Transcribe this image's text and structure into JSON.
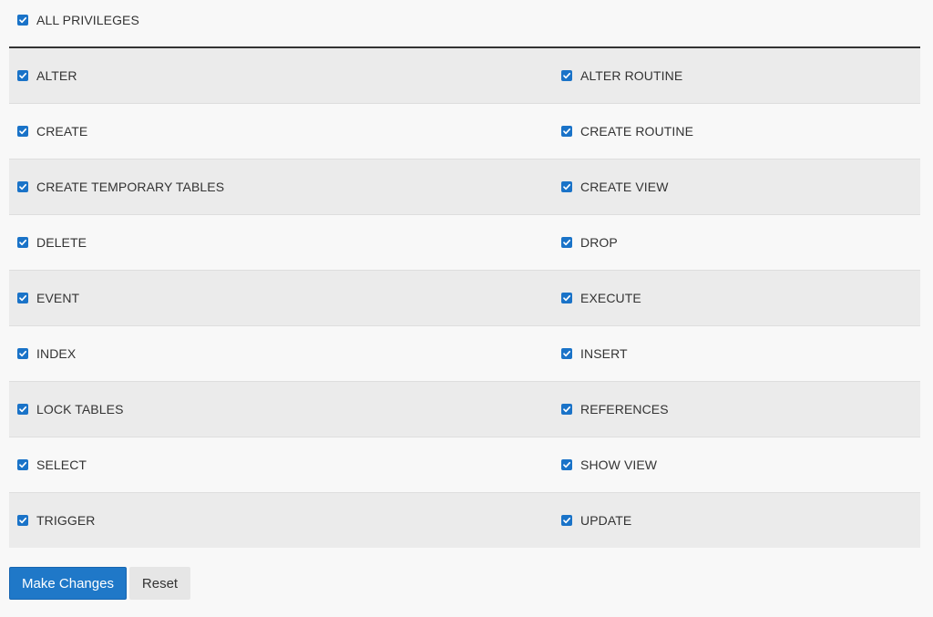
{
  "all_privileges": {
    "label": "ALL PRIVILEGES",
    "checked": true
  },
  "privileges": [
    {
      "left": "ALTER",
      "right": "ALTER ROUTINE"
    },
    {
      "left": "CREATE",
      "right": "CREATE ROUTINE"
    },
    {
      "left": "CREATE TEMPORARY TABLES",
      "right": "CREATE VIEW"
    },
    {
      "left": "DELETE",
      "right": "DROP"
    },
    {
      "left": "EVENT",
      "right": "EXECUTE"
    },
    {
      "left": "INDEX",
      "right": "INSERT"
    },
    {
      "left": "LOCK TABLES",
      "right": "REFERENCES"
    },
    {
      "left": "SELECT",
      "right": "SHOW VIEW"
    },
    {
      "left": "TRIGGER",
      "right": "UPDATE"
    }
  ],
  "actions": {
    "make_changes": "Make Changes",
    "reset": "Reset"
  },
  "colors": {
    "accent": "#1f78c8",
    "checkbox": "#1a73c8"
  }
}
